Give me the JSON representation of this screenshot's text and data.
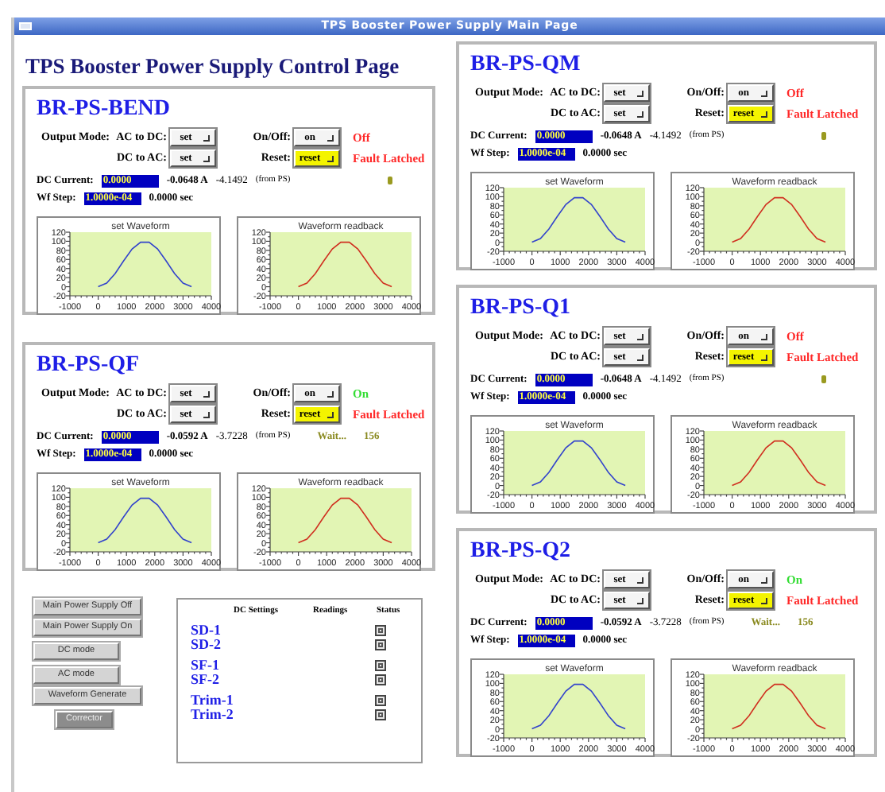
{
  "window": {
    "title": "TPS Booster Power Supply Main Page"
  },
  "page_title": "TPS Booster Power Supply Control Page",
  "left_panels": [
    {
      "name": "BR-PS-BEND",
      "output_mode_label": "Output Mode:",
      "ac_to_dc_label": "AC to DC:",
      "ac_to_dc_button": "set",
      "dc_to_ac_label": "DC to AC:",
      "dc_to_ac_button": "set",
      "onoff_label": "On/Off:",
      "onoff_button": "on",
      "power_status": {
        "text": "Off",
        "on": false
      },
      "reset_label": "Reset:",
      "reset_button": "reset",
      "fault_status": "Fault Latched",
      "busy": false,
      "dc_current_label": "DC Current:",
      "dc_current_value": "0.0000",
      "dc_current_reading": "-0.0648 A",
      "dc_current_ps": "-4.1492",
      "dc_current_source": "(from PS)",
      "wf_step_label": "Wf Step:",
      "wf_step_value": "1.0000e-04",
      "wf_step_reading": "0.0000 sec",
      "charts": [
        {
          "chart_data": {
            "type": "line",
            "title": "set Waveform",
            "x": [
              0,
              300,
              600,
              900,
              1200,
              1500,
              1800,
              2100,
              2400,
              2700,
              3000,
              3300
            ],
            "series": [
              {
                "color": "#3344cc",
                "values": [
                  0,
                  8,
                  29,
                  57,
                  83,
                  98,
                  98,
                  83,
                  57,
                  29,
                  8,
                  0
                ]
              }
            ],
            "xlim": [
              -1000,
              4000
            ],
            "ylim": [
              -20,
              120
            ],
            "xticks": [
              -1000,
              0,
              1000,
              2000,
              3000,
              4000
            ],
            "yticks": [
              -20,
              0,
              20,
              40,
              60,
              80,
              100,
              120
            ]
          }
        },
        {
          "chart_data": {
            "type": "line",
            "title": "Waveform readback",
            "x": [
              0,
              300,
              600,
              900,
              1200,
              1500,
              1800,
              2100,
              2400,
              2700,
              3000,
              3300
            ],
            "series": [
              {
                "color": "#d03020",
                "values": [
                  0,
                  8,
                  29,
                  57,
                  83,
                  98,
                  98,
                  83,
                  57,
                  29,
                  8,
                  0
                ]
              }
            ],
            "xlim": [
              -1000,
              4000
            ],
            "ylim": [
              -20,
              120
            ],
            "xticks": [
              -1000,
              0,
              1000,
              2000,
              3000,
              4000
            ],
            "yticks": [
              -20,
              0,
              20,
              40,
              60,
              80,
              100,
              120
            ]
          }
        }
      ]
    },
    {
      "name": "BR-PS-QF",
      "output_mode_label": "Output Mode:",
      "ac_to_dc_label": "AC to DC:",
      "ac_to_dc_button": "set",
      "dc_to_ac_label": "DC to AC:",
      "dc_to_ac_button": "set",
      "onoff_label": "On/Off:",
      "onoff_button": "on",
      "power_status": {
        "text": "On",
        "on": true
      },
      "reset_label": "Reset:",
      "reset_button": "reset",
      "fault_status": "Fault Latched",
      "busy": true,
      "wait_text": "Wait...",
      "wait_count": "156",
      "dc_current_label": "DC Current:",
      "dc_current_value": "0.0000",
      "dc_current_reading": "-0.0592 A",
      "dc_current_ps": "-3.7228",
      "dc_current_source": "(from PS)",
      "wf_step_label": "Wf Step:",
      "wf_step_value": "1.0000e-04",
      "wf_step_reading": "0.0000 sec",
      "charts": [
        {
          "chart_data": {
            "type": "line",
            "title": "set Waveform",
            "x": [
              0,
              300,
              600,
              900,
              1200,
              1500,
              1800,
              2100,
              2400,
              2700,
              3000,
              3300
            ],
            "series": [
              {
                "color": "#3344cc",
                "values": [
                  0,
                  8,
                  29,
                  57,
                  83,
                  98,
                  98,
                  83,
                  57,
                  29,
                  8,
                  0
                ]
              }
            ],
            "xlim": [
              -1000,
              4000
            ],
            "ylim": [
              -20,
              120
            ],
            "xticks": [
              -1000,
              0,
              1000,
              2000,
              3000,
              4000
            ],
            "yticks": [
              -20,
              0,
              20,
              40,
              60,
              80,
              100,
              120
            ]
          }
        },
        {
          "chart_data": {
            "type": "line",
            "title": "Waveform readback",
            "x": [
              0,
              300,
              600,
              900,
              1200,
              1500,
              1800,
              2100,
              2400,
              2700,
              3000,
              3300
            ],
            "series": [
              {
                "color": "#d03020",
                "values": [
                  0,
                  8,
                  29,
                  57,
                  83,
                  98,
                  98,
                  83,
                  57,
                  29,
                  8,
                  0
                ]
              }
            ],
            "xlim": [
              -1000,
              4000
            ],
            "ylim": [
              -20,
              120
            ],
            "xticks": [
              -1000,
              0,
              1000,
              2000,
              3000,
              4000
            ],
            "yticks": [
              -20,
              0,
              20,
              40,
              60,
              80,
              100,
              120
            ]
          }
        }
      ]
    }
  ],
  "main_buttons": [
    {
      "label": "Main Power Supply Off",
      "kind": "wide"
    },
    {
      "label": "Main Power Supply On",
      "kind": "wide"
    },
    {
      "label": "DC mode",
      "kind": "narrow"
    },
    {
      "label": "AC mode",
      "kind": "narrow"
    },
    {
      "label": "Waveform Generate",
      "kind": "wide"
    },
    {
      "label": "Corrector",
      "kind": "dark"
    }
  ],
  "magnet_table": {
    "columns": [
      "DC Settings",
      "Readings",
      "Status"
    ],
    "groups": [
      {
        "rows": [
          {
            "name": "SD-1"
          },
          {
            "name": "SD-2"
          }
        ]
      },
      {
        "rows": [
          {
            "name": "SF-1"
          },
          {
            "name": "SF-2"
          }
        ]
      },
      {
        "rows": [
          {
            "name": "Trim-1"
          },
          {
            "name": "Trim-2"
          }
        ]
      }
    ]
  },
  "right_panels": [
    {
      "name": "BR-PS-QM",
      "output_mode_label": "Output Mode:",
      "ac_to_dc_label": "AC to DC:",
      "ac_to_dc_button": "set",
      "dc_to_ac_label": "DC to AC:",
      "dc_to_ac_button": "set",
      "onoff_label": "On/Off:",
      "onoff_button": "on",
      "power_status": {
        "text": "Off",
        "on": false
      },
      "reset_label": "Reset:",
      "reset_button": "reset",
      "fault_status": "Fault Latched",
      "busy": false,
      "dc_current_label": "DC Current:",
      "dc_current_value": "0.0000",
      "dc_current_reading": "-0.0648 A",
      "dc_current_ps": "-4.1492",
      "dc_current_source": "(from PS)",
      "wf_step_label": "Wf Step:",
      "wf_step_value": "1.0000e-04",
      "wf_step_reading": "0.0000 sec",
      "charts": [
        {
          "chart_data": {
            "type": "line",
            "title": "set Waveform",
            "x": [
              0,
              300,
              600,
              900,
              1200,
              1500,
              1800,
              2100,
              2400,
              2700,
              3000,
              3300
            ],
            "series": [
              {
                "color": "#3344cc",
                "values": [
                  0,
                  8,
                  29,
                  57,
                  83,
                  98,
                  98,
                  83,
                  57,
                  29,
                  8,
                  0
                ]
              }
            ],
            "xlim": [
              -1000,
              4000
            ],
            "ylim": [
              -20,
              120
            ],
            "xticks": [
              -1000,
              0,
              1000,
              2000,
              3000,
              4000
            ],
            "yticks": [
              -20,
              0,
              20,
              40,
              60,
              80,
              100,
              120
            ]
          }
        },
        {
          "chart_data": {
            "type": "line",
            "title": "Waveform readback",
            "x": [
              0,
              300,
              600,
              900,
              1200,
              1500,
              1800,
              2100,
              2400,
              2700,
              3000,
              3300
            ],
            "series": [
              {
                "color": "#d03020",
                "values": [
                  0,
                  8,
                  29,
                  57,
                  83,
                  98,
                  98,
                  83,
                  57,
                  29,
                  8,
                  0
                ]
              }
            ],
            "xlim": [
              -1000,
              4000
            ],
            "ylim": [
              -20,
              120
            ],
            "xticks": [
              -1000,
              0,
              1000,
              2000,
              3000,
              4000
            ],
            "yticks": [
              -20,
              0,
              20,
              40,
              60,
              80,
              100,
              120
            ]
          }
        }
      ]
    },
    {
      "name": "BR-PS-Q1",
      "output_mode_label": "Output Mode:",
      "ac_to_dc_label": "AC to DC:",
      "ac_to_dc_button": "set",
      "dc_to_ac_label": "DC to AC:",
      "dc_to_ac_button": "set",
      "onoff_label": "On/Off:",
      "onoff_button": "on",
      "power_status": {
        "text": "Off",
        "on": false
      },
      "reset_label": "Reset:",
      "reset_button": "reset",
      "fault_status": "Fault Latched",
      "busy": false,
      "dc_current_label": "DC Current:",
      "dc_current_value": "0.0000",
      "dc_current_reading": "-0.0648 A",
      "dc_current_ps": "-4.1492",
      "dc_current_source": "(from PS)",
      "wf_step_label": "Wf Step:",
      "wf_step_value": "1.0000e-04",
      "wf_step_reading": "0.0000 sec",
      "charts": [
        {
          "chart_data": {
            "type": "line",
            "title": "set Waveform",
            "x": [
              0,
              300,
              600,
              900,
              1200,
              1500,
              1800,
              2100,
              2400,
              2700,
              3000,
              3300
            ],
            "series": [
              {
                "color": "#3344cc",
                "values": [
                  0,
                  8,
                  29,
                  57,
                  83,
                  98,
                  98,
                  83,
                  57,
                  29,
                  8,
                  0
                ]
              }
            ],
            "xlim": [
              -1000,
              4000
            ],
            "ylim": [
              -20,
              120
            ],
            "xticks": [
              -1000,
              0,
              1000,
              2000,
              3000,
              4000
            ],
            "yticks": [
              -20,
              0,
              20,
              40,
              60,
              80,
              100,
              120
            ]
          }
        },
        {
          "chart_data": {
            "type": "line",
            "title": "Waveform readback",
            "x": [
              0,
              300,
              600,
              900,
              1200,
              1500,
              1800,
              2100,
              2400,
              2700,
              3000,
              3300
            ],
            "series": [
              {
                "color": "#d03020",
                "values": [
                  0,
                  8,
                  29,
                  57,
                  83,
                  98,
                  98,
                  83,
                  57,
                  29,
                  8,
                  0
                ]
              }
            ],
            "xlim": [
              -1000,
              4000
            ],
            "ylim": [
              -20,
              120
            ],
            "xticks": [
              -1000,
              0,
              1000,
              2000,
              3000,
              4000
            ],
            "yticks": [
              -20,
              0,
              20,
              40,
              60,
              80,
              100,
              120
            ]
          }
        }
      ]
    },
    {
      "name": "BR-PS-Q2",
      "output_mode_label": "Output Mode:",
      "ac_to_dc_label": "AC to DC:",
      "ac_to_dc_button": "set",
      "dc_to_ac_label": "DC to AC:",
      "dc_to_ac_button": "set",
      "onoff_label": "On/Off:",
      "onoff_button": "on",
      "power_status": {
        "text": "On",
        "on": true
      },
      "reset_label": "Reset:",
      "reset_button": "reset",
      "fault_status": "Fault Latched",
      "busy": true,
      "wait_text": "Wait...",
      "wait_count": "156",
      "dc_current_label": "DC Current:",
      "dc_current_value": "0.0000",
      "dc_current_reading": "-0.0592 A",
      "dc_current_ps": "-3.7228",
      "dc_current_source": "(from PS)",
      "wf_step_label": "Wf Step:",
      "wf_step_value": "1.0000e-04",
      "wf_step_reading": "0.0000 sec",
      "charts": [
        {
          "chart_data": {
            "type": "line",
            "title": "set Waveform",
            "x": [
              0,
              300,
              600,
              900,
              1200,
              1500,
              1800,
              2100,
              2400,
              2700,
              3000,
              3300
            ],
            "series": [
              {
                "color": "#3344cc",
                "values": [
                  0,
                  8,
                  29,
                  57,
                  83,
                  98,
                  98,
                  83,
                  57,
                  29,
                  8,
                  0
                ]
              }
            ],
            "xlim": [
              -1000,
              4000
            ],
            "ylim": [
              -20,
              120
            ],
            "xticks": [
              -1000,
              0,
              1000,
              2000,
              3000,
              4000
            ],
            "yticks": [
              -20,
              0,
              20,
              40,
              60,
              80,
              100,
              120
            ]
          }
        },
        {
          "chart_data": {
            "type": "line",
            "title": "Waveform readback",
            "x": [
              0,
              300,
              600,
              900,
              1200,
              1500,
              1800,
              2100,
              2400,
              2700,
              3000,
              3300
            ],
            "series": [
              {
                "color": "#d03020",
                "values": [
                  0,
                  8,
                  29,
                  57,
                  83,
                  98,
                  98,
                  83,
                  57,
                  29,
                  8,
                  0
                ]
              }
            ],
            "xlim": [
              -1000,
              4000
            ],
            "ylim": [
              -20,
              120
            ],
            "xticks": [
              -1000,
              0,
              1000,
              2000,
              3000,
              4000
            ],
            "yticks": [
              -20,
              0,
              20,
              40,
              60,
              80,
              100,
              120
            ]
          }
        }
      ]
    }
  ]
}
